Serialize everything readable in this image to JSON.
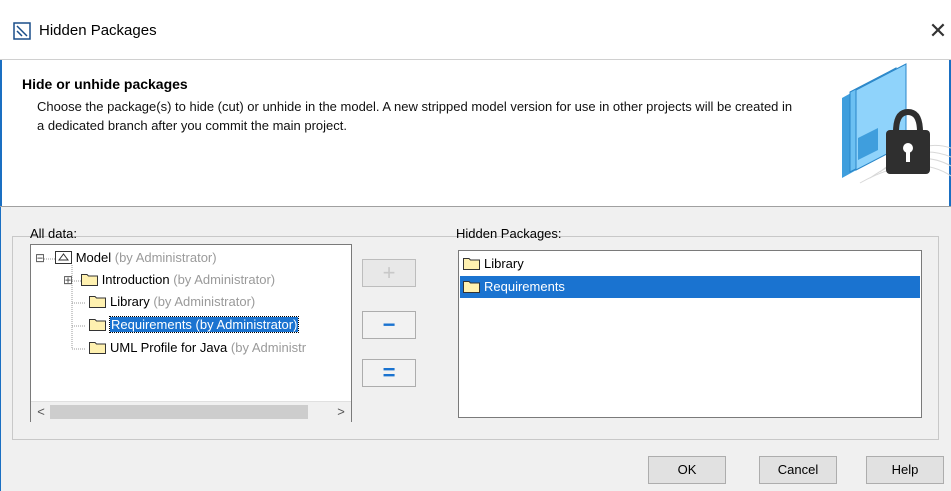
{
  "window": {
    "title": "Hidden Packages",
    "title_icon": "dialog-icon",
    "close_glyph": "✕"
  },
  "header": {
    "heading": "Hide or unhide packages",
    "description": "Choose the package(s) to hide (cut) or unhide in the model. A new stripped model version for use in other projects will be created in a dedicated branch after you commit the main project.",
    "art_icon": "folder-lock-icon"
  },
  "all_data": {
    "label": "All data:",
    "tree": [
      {
        "name": "Model",
        "owner": "(by Administrator)",
        "expander": "⊟",
        "icon": "package-icon"
      },
      {
        "name": "Introduction",
        "owner": "(by Administrator)",
        "expander": "⊞",
        "icon": "folder-icon"
      },
      {
        "name": "Library",
        "owner": "(by Administrator)",
        "icon": "folder-icon"
      },
      {
        "name": "Requirements (by Administrator)",
        "owner": "",
        "icon": "folder-icon",
        "selected": true
      },
      {
        "name": "UML Profile for Java",
        "owner": "(by Administr",
        "icon": "folder-icon"
      }
    ],
    "scroll_left": "<",
    "scroll_right": ">"
  },
  "move_buttons": {
    "add": "+",
    "remove": "−",
    "remove_all": "="
  },
  "hidden_packages": {
    "label": "Hidden Packages:",
    "items": [
      {
        "name": "Library",
        "icon": "folder-icon"
      },
      {
        "name": "Requirements",
        "icon": "folder-icon",
        "selected": true
      }
    ]
  },
  "buttons": {
    "ok": "OK",
    "cancel": "Cancel",
    "help": "Help"
  },
  "colors": {
    "accent": "#1a73d0",
    "folder": "#fff1b0",
    "muted_text": "#9a9a9a"
  }
}
